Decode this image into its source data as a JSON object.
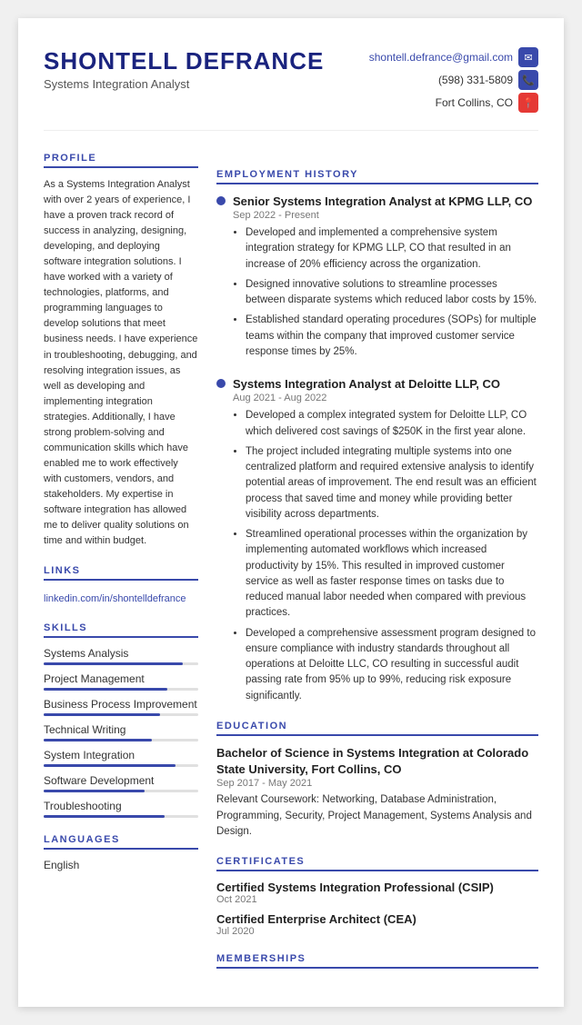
{
  "header": {
    "name": "SHONTELL DEFRANCE",
    "title": "Systems Integration Analyst",
    "email": "shontell.defrance@gmail.com",
    "phone": "(598) 331-5809",
    "location": "Fort Collins, CO"
  },
  "profile": {
    "section_label": "PROFILE",
    "text": "As a Systems Integration Analyst with over 2 years of experience, I have a proven track record of success in analyzing, designing, developing, and deploying software integration solutions. I have worked with a variety of technologies, platforms, and programming languages to develop solutions that meet business needs. I have experience in troubleshooting, debugging, and resolving integration issues, as well as developing and implementing integration strategies. Additionally, I have strong problem-solving and communication skills which have enabled me to work effectively with customers, vendors, and stakeholders. My expertise in software integration has allowed me to deliver quality solutions on time and within budget."
  },
  "links": {
    "section_label": "LINKS",
    "linkedin": "linkedin.com/in/shontelldefrance"
  },
  "skills": {
    "section_label": "SKILLS",
    "items": [
      {
        "name": "Systems Analysis",
        "level": 90
      },
      {
        "name": "Project Management",
        "level": 80
      },
      {
        "name": "Business Process Improvement",
        "level": 75
      },
      {
        "name": "Technical Writing",
        "level": 70
      },
      {
        "name": "System Integration",
        "level": 85
      },
      {
        "name": "Software Development",
        "level": 65
      },
      {
        "name": "Troubleshooting",
        "level": 78
      }
    ]
  },
  "languages": {
    "section_label": "LANGUAGES",
    "items": [
      {
        "name": "English"
      }
    ]
  },
  "employment": {
    "section_label": "EMPLOYMENT HISTORY",
    "jobs": [
      {
        "title": "Senior Systems Integration Analyst at KPMG LLP, CO",
        "dates": "Sep 2022 - Present",
        "bullets": [
          "Developed and implemented a comprehensive system integration strategy for KPMG LLP, CO that resulted in an increase of 20% efficiency across the organization.",
          "Designed innovative solutions to streamline processes between disparate systems which reduced labor costs by 15%.",
          "Established standard operating procedures (SOPs) for multiple teams within the company that improved customer service response times by 25%."
        ]
      },
      {
        "title": "Systems Integration Analyst at Deloitte LLP, CO",
        "dates": "Aug 2021 - Aug 2022",
        "bullets": [
          "Developed a complex integrated system for Deloitte LLP, CO which delivered cost savings of $250K in the first year alone.",
          "The project included integrating multiple systems into one centralized platform and required extensive analysis to identify potential areas of improvement. The end result was an efficient process that saved time and money while providing better visibility across departments.",
          "Streamlined operational processes within the organization by implementing automated workflows which increased productivity by 15%. This resulted in improved customer service as well as faster response times on tasks due to reduced manual labor needed when compared with previous practices.",
          "Developed a comprehensive assessment program designed to ensure compliance with industry standards throughout all operations at Deloitte LLC, CO resulting in successful audit passing rate from 95% up to 99%, reducing risk exposure significantly."
        ]
      }
    ]
  },
  "education": {
    "section_label": "EDUCATION",
    "degree": "Bachelor of Science in Systems Integration at Colorado State University, Fort Collins, CO",
    "dates": "Sep 2017 - May 2021",
    "coursework": "Relevant Coursework: Networking, Database Administration, Programming, Security, Project Management, Systems Analysis and Design."
  },
  "certificates": {
    "section_label": "CERTIFICATES",
    "items": [
      {
        "name": "Certified Systems Integration Professional (CSIP)",
        "date": "Oct 2021"
      },
      {
        "name": "Certified Enterprise Architect (CEA)",
        "date": "Jul 2020"
      }
    ]
  },
  "memberships": {
    "section_label": "MEMBERSHIPS"
  }
}
